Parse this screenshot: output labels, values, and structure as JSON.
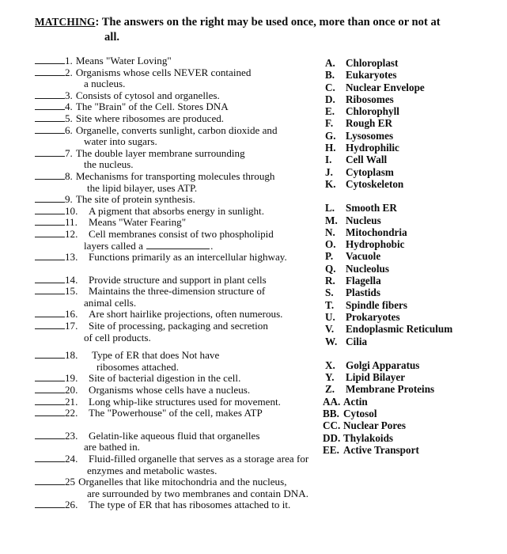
{
  "heading": {
    "label": "MATCHING",
    "colon": ":",
    "text": "The answers on the right may be used once, more than once or not at",
    "tail": "all."
  },
  "questions": [
    {
      "num": "1.",
      "lines": [
        "Means \"Water Loving\""
      ]
    },
    {
      "num": "2.",
      "lines": [
        "Organisms whose cells NEVER contained",
        "a nucleus."
      ]
    },
    {
      "num": "3.",
      "lines": [
        "Consists of cytosol and organelles."
      ]
    },
    {
      "num": "4.",
      "lines": [
        "The \"Brain\" of the Cell. Stores DNA"
      ]
    },
    {
      "num": "5.",
      "lines": [
        "Site where ribosomes are produced."
      ]
    },
    {
      "num": "6.",
      "lines": [
        "Organelle, converts sunlight, carbon dioxide and",
        "water into sugars."
      ]
    },
    {
      "num": "7.",
      "lines": [
        "The double layer membrane surrounding",
        "the nucleus."
      ]
    },
    {
      "num": "8.",
      "lines": [
        "Mechanisms for transporting molecules through",
        "the lipid bilayer, uses ATP."
      ]
    },
    {
      "num": "9.",
      "lines": [
        "The site of protein synthesis."
      ]
    },
    {
      "num": "10.",
      "lines": [
        "A pigment that absorbs energy in sunlight."
      ]
    },
    {
      "num": "11.",
      "lines": [
        "Means \"Water Fearing\""
      ]
    },
    {
      "num": "12.",
      "lines": [
        "Cell membranes consist of two phospholipid",
        "layers called a ____________."
      ]
    },
    {
      "num": "13.",
      "lines": [
        "Functions primarily as an intercellular highway."
      ]
    },
    {
      "num": "14.",
      "lines": [
        "Provide structure and support in plant cells"
      ]
    },
    {
      "num": "15.",
      "lines": [
        "Maintains the three-dimension structure of",
        "animal cells."
      ]
    },
    {
      "num": "16.",
      "lines": [
        "Are short hairlike projections, often numerous."
      ]
    },
    {
      "num": "17.",
      "lines": [
        "Site of processing, packaging and secretion",
        "of cell products."
      ]
    },
    {
      "num": "18.",
      "lines": [
        "Type of ER that does Not have",
        "ribosomes attached."
      ]
    },
    {
      "num": "19.",
      "lines": [
        "Site of bacterial digestion in the cell."
      ]
    },
    {
      "num": "20.",
      "lines": [
        "Organisms whose cells have a nucleus."
      ]
    },
    {
      "num": "21.",
      "lines": [
        "Long whip-like structures used for movement."
      ]
    },
    {
      "num": "22.",
      "lines": [
        "The \"Powerhouse\" of the cell, makes ATP"
      ]
    },
    {
      "num": "23.",
      "lines": [
        "Gelatin-like aqueous fluid that organelles",
        "are bathed in."
      ]
    },
    {
      "num": "24.",
      "lines": [
        "Fluid-filled organelle that serves as a storage area for",
        "enzymes and metabolic wastes."
      ]
    },
    {
      "num": "25",
      "lines": [
        "Organelles that like mitochondria and the nucleus,",
        "are surrounded by two membranes and contain DNA."
      ]
    },
    {
      "num": "26.",
      "lines": [
        "The type of ER that has ribosomes attached to it."
      ]
    }
  ],
  "answers_group1": [
    {
      "key": "A.",
      "value": "Chloroplast"
    },
    {
      "key": "B.",
      "value": "Eukaryotes"
    },
    {
      "key": "C.",
      "value": "Nuclear Envelope"
    },
    {
      "key": "D.",
      "value": "Ribosomes"
    },
    {
      "key": "E.",
      "value": "Chlorophyll"
    },
    {
      "key": "F.",
      "value": "Rough ER"
    },
    {
      "key": "G.",
      "value": "Lysosomes"
    },
    {
      "key": "H.",
      "value": "Hydrophilic"
    },
    {
      "key": "I.",
      "value": "Cell Wall"
    },
    {
      "key": "J.",
      "value": "Cytoplasm"
    },
    {
      "key": "K.",
      "value": "Cytoskeleton"
    }
  ],
  "answers_group2": [
    {
      "key": "L.",
      "value": "Smooth ER"
    },
    {
      "key": "M.",
      "value": "Nucleus"
    },
    {
      "key": "N.",
      "value": "Mitochondria"
    },
    {
      "key": "O.",
      "value": "Hydrophobic"
    },
    {
      "key": "P.",
      "value": "Vacuole"
    },
    {
      "key": "Q.",
      "value": "Nucleolus"
    },
    {
      "key": "R.",
      "value": "Flagella"
    },
    {
      "key": "S.",
      "value": "Plastids"
    },
    {
      "key": "T.",
      "value": "Spindle fibers"
    },
    {
      "key": "U.",
      "value": "Prokaryotes"
    },
    {
      "key": "V.",
      "value": "Endoplasmic Reticulum"
    },
    {
      "key": "W.",
      "value": "Cilia"
    }
  ],
  "answers_group3": [
    {
      "key": "X.",
      "value": "Golgi Apparatus"
    },
    {
      "key": "Y.",
      "value": "Lipid Bilayer"
    },
    {
      "key": "Z.",
      "value": "Membrane Proteins"
    },
    {
      "key": "AA.",
      "value": "Actin"
    },
    {
      "key": "BB.",
      "value": "Cytosol"
    },
    {
      "key": "CC.",
      "value": "Nuclear Pores"
    },
    {
      "key": "DD.",
      "value": "Thylakoids"
    },
    {
      "key": "EE.",
      "value": "Active Transport"
    }
  ]
}
